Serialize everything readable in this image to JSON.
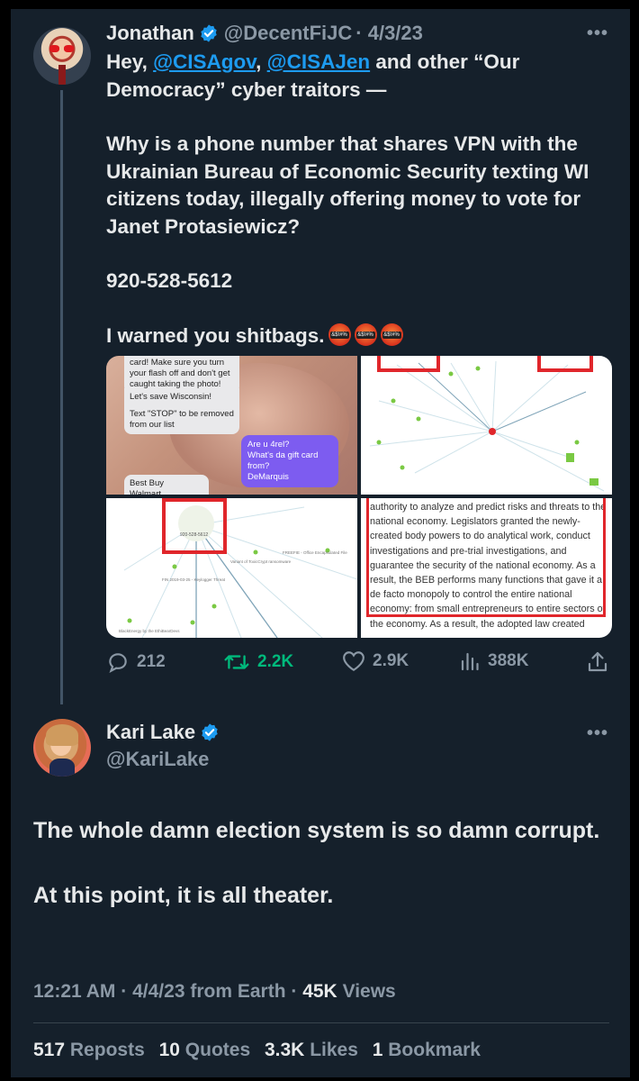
{
  "parent_tweet": {
    "name": "Jonathan",
    "handle": "@DecentFiJC",
    "date": "· 4/3/23",
    "body": {
      "greeting": "Hey, ",
      "mention1": "@CISAgov",
      "sep": ", ",
      "mention2": "@CISAJen",
      "rest_line1": " and other “Our Democracy” cyber traitors —",
      "question": "Why is a phone number that shares VPN with the Ukrainian Bureau of Economic Security texting WI citizens today, illegally offering money to vote for Janet Protasiewicz?",
      "phone": "920-528-5612",
      "closing": "I warned you shitbags."
    },
    "emoji_text": "&$!#%",
    "media": {
      "sms": {
        "message1": "card! Make sure you turn your flash off and don't get caught taking the photo!",
        "message2": "Let's save Wisconsin!",
        "message3": "Text \"STOP\" to be removed from our list",
        "reply": "Are u 4rel?\nWhat's da gift card from?\nDeMarquis",
        "message4": "Best Buy\nWalmart"
      },
      "graph_labels": {
        "node_number": "920-528-5612",
        "label1": "Variant of ToxicCrypt ransomware",
        "label2": "FIN 2019-03-25 - Keylogger Threat",
        "label3": "FREEFIE - Office Encapsulated File",
        "label4": "BlackEnergy by the EthiBearDevs",
        "label5": "C2 BBC Spiring CA BEO",
        "label6": "Bringing to the DNS-Entry",
        "label7": "Malware from Toxics Distribution"
      },
      "document_text": "authority to analyze and predict risks and threats to the national economy. Legislators granted the newly-created body powers to do analytical work, conduct investigations and pre-trial investigations, and guarantee the security of the national economy. As a result, the BEB performs many functions that gave it a de facto monopoly to control the entire national economy: from small entrepreneurs to entire sectors of the economy. As a result, the adopted law created"
    },
    "actions": {
      "replies": "212",
      "reposts": "2.2K",
      "likes": "2.9K",
      "views": "388K"
    }
  },
  "main_tweet": {
    "name": "Kari Lake",
    "handle": "@KariLake",
    "paragraph1": "The whole damn election system is so damn corrupt.",
    "paragraph2": "At this point, it is all theater.",
    "time": "12:21 AM",
    "date": "4/4/23",
    "location": "from Earth",
    "views_count": "45K",
    "views_label": "Views",
    "stats": {
      "reposts_count": "517",
      "reposts_label": "Reposts",
      "quotes_count": "10",
      "quotes_label": "Quotes",
      "likes_count": "3.3K",
      "likes_label": "Likes",
      "bookmarks_count": "1",
      "bookmarks_label": "Bookmark"
    }
  },
  "colors": {
    "background": "#15202b",
    "accent": "#1d9bf0",
    "secondary_text": "#8b98a5",
    "repost_green": "#00ba7c",
    "highlight_red": "#e0262b"
  },
  "icons": [
    "verified-badge-icon",
    "more-options-icon",
    "reply-icon",
    "repost-icon",
    "like-icon",
    "views-icon",
    "share-icon"
  ]
}
